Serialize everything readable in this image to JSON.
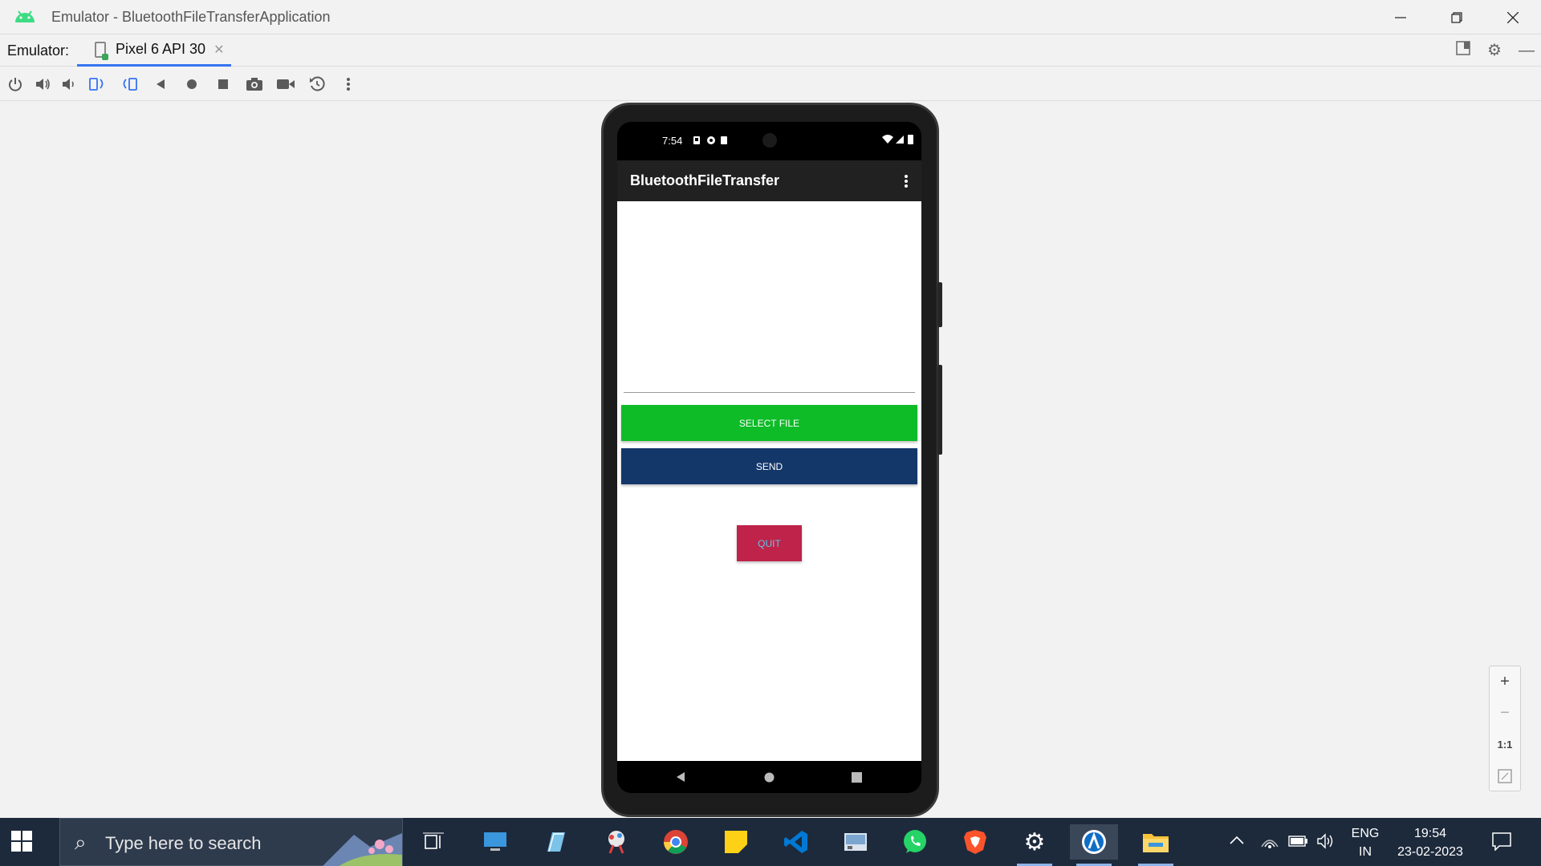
{
  "window": {
    "title": "Emulator - BluetoothFileTransferApplication",
    "controls": [
      "minimize",
      "restore",
      "close"
    ]
  },
  "tabbar": {
    "label": "Emulator:",
    "tab_label": "Pixel 6 API 30",
    "tab_close": "✕"
  },
  "toolbar": {
    "buttons": [
      "power",
      "volume-up",
      "volume-down",
      "rotate-left",
      "rotate-right",
      "back",
      "home",
      "overview",
      "screenshot",
      "screen-record",
      "snapshot",
      "more"
    ]
  },
  "device": {
    "status_time": "7:54",
    "app_title": "BluetoothFileTransfer",
    "buttons": {
      "select_file": "SELECT FILE",
      "send": "SEND",
      "quit": "QUIT"
    },
    "colors": {
      "select_file": "#0dbc27",
      "send": "#14376a",
      "quit": "#bf2349",
      "quit_text": "#5ec8e8"
    }
  },
  "zoom": {
    "plus": "+",
    "minus": "−",
    "one_to_one": "1:1"
  },
  "taskbar": {
    "search_placeholder": "Type here to search",
    "language_top": "ENG",
    "language_bottom": "IN",
    "clock_time": "19:54",
    "clock_date": "23-02-2023"
  }
}
